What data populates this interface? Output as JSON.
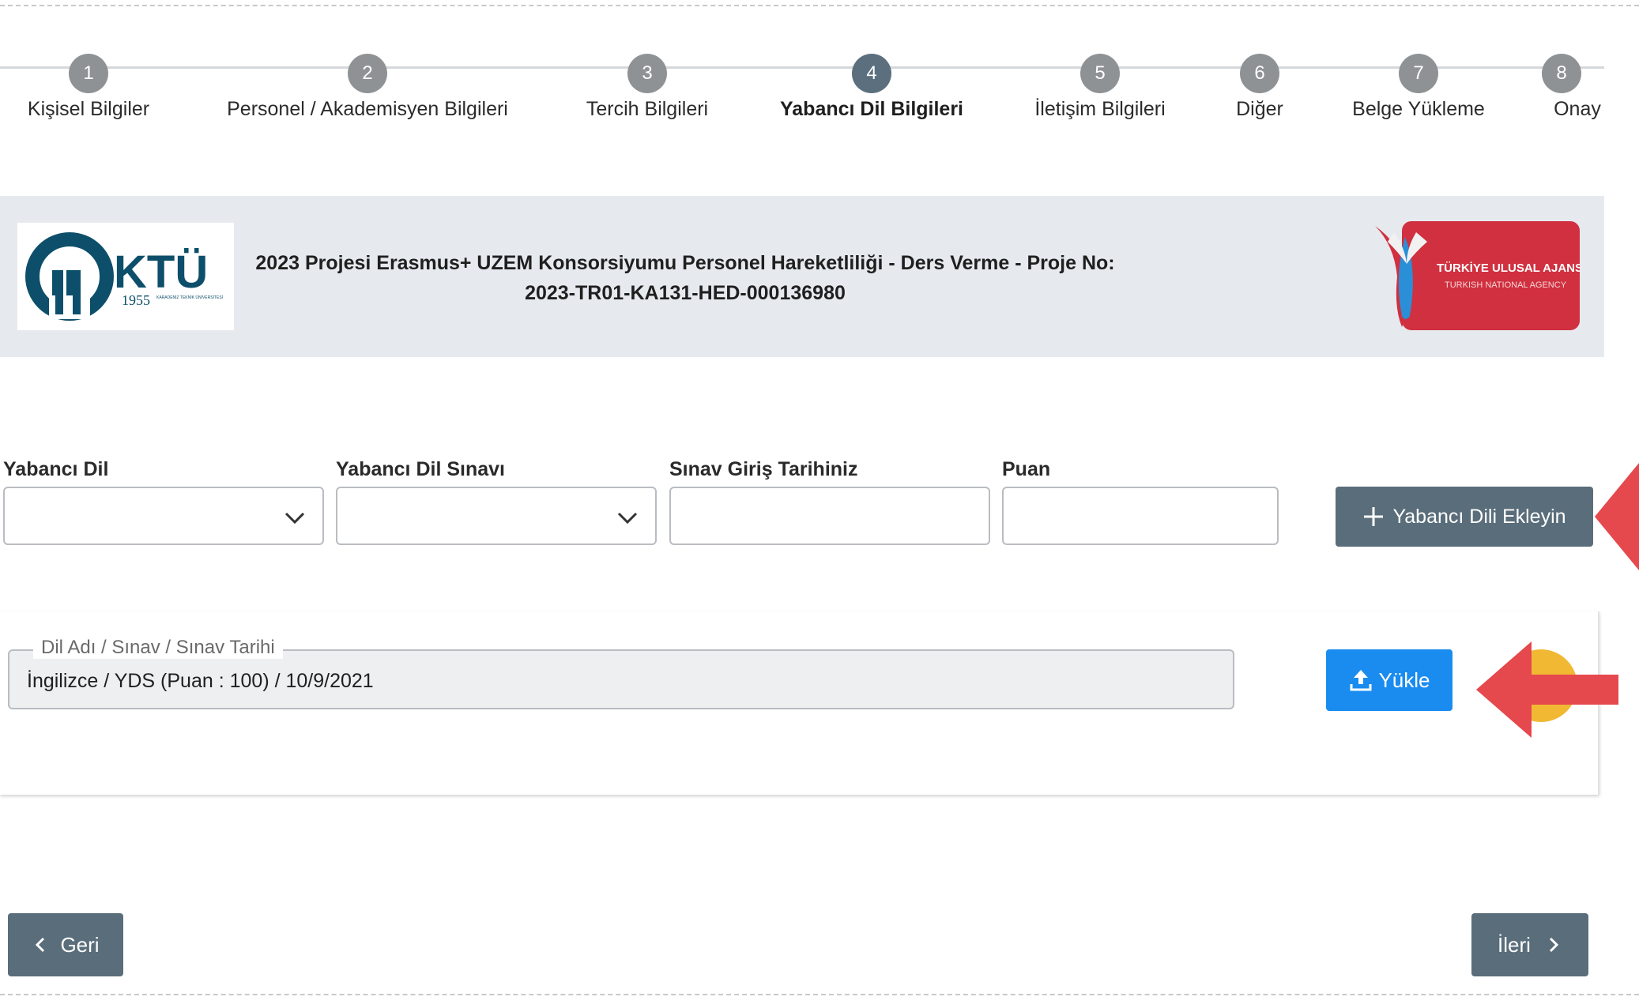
{
  "steps": [
    {
      "number": "1",
      "label": "Kişisel Bilgiler"
    },
    {
      "number": "2",
      "label": "Personel / Akademisyen Bilgileri"
    },
    {
      "number": "3",
      "label": "Tercih Bilgileri"
    },
    {
      "number": "4",
      "label": "Yabancı Dil Bilgileri"
    },
    {
      "number": "5",
      "label": "İletişim Bilgileri"
    },
    {
      "number": "6",
      "label": "Diğer"
    },
    {
      "number": "7",
      "label": "Belge Yükleme"
    },
    {
      "number": "8",
      "label": "Onay"
    }
  ],
  "active_step": "4",
  "banner": {
    "title": "2023 Projesi Erasmus+ UZEM Konsorsiyumu Personel Hareketliliği - Ders Verme - Proje No: 2023-TR01-KA131-HED-000136980",
    "ktu_logo_text": "KTÜ",
    "ktu_logo_year": "1955",
    "ktu_logo_subtitle": "KARADENİZ TEKNİK ÜNİVERSİTESİ",
    "agency_logo_line1": "TÜRKİYE ULUSAL AJANSI",
    "agency_logo_line2": "TURKISH NATIONAL AGENCY"
  },
  "form": {
    "foreign_language_label": "Yabancı Dil",
    "foreign_language_value": "",
    "exam_label": "Yabancı Dil Sınavı",
    "exam_value": "",
    "exam_date_label": "Sınav Giriş Tarihiniz",
    "exam_date_value": "",
    "score_label": "Puan",
    "score_value": "",
    "add_button": "Yabancı Dili Ekleyin"
  },
  "record": {
    "legend": "Dil Adı / Sınav / Sınav Tarihi",
    "value": "İngilizce / YDS (Puan : 100) / 10/9/2021",
    "upload_button": "Yükle"
  },
  "nav": {
    "back": "Geri",
    "next": "İleri"
  },
  "colors": {
    "step_inactive": "#8f9295",
    "step_active": "#5b6f7e",
    "button_gray": "#5a6d7a",
    "button_blue": "#1a8cf0",
    "arrow_red": "#e5484d",
    "banner_bg": "#e6eaef"
  },
  "icons": {
    "chevron": "chevron-down-icon",
    "plus": "plus-icon",
    "upload": "upload-icon",
    "back": "chevron-left-icon",
    "next": "chevron-right-icon"
  }
}
